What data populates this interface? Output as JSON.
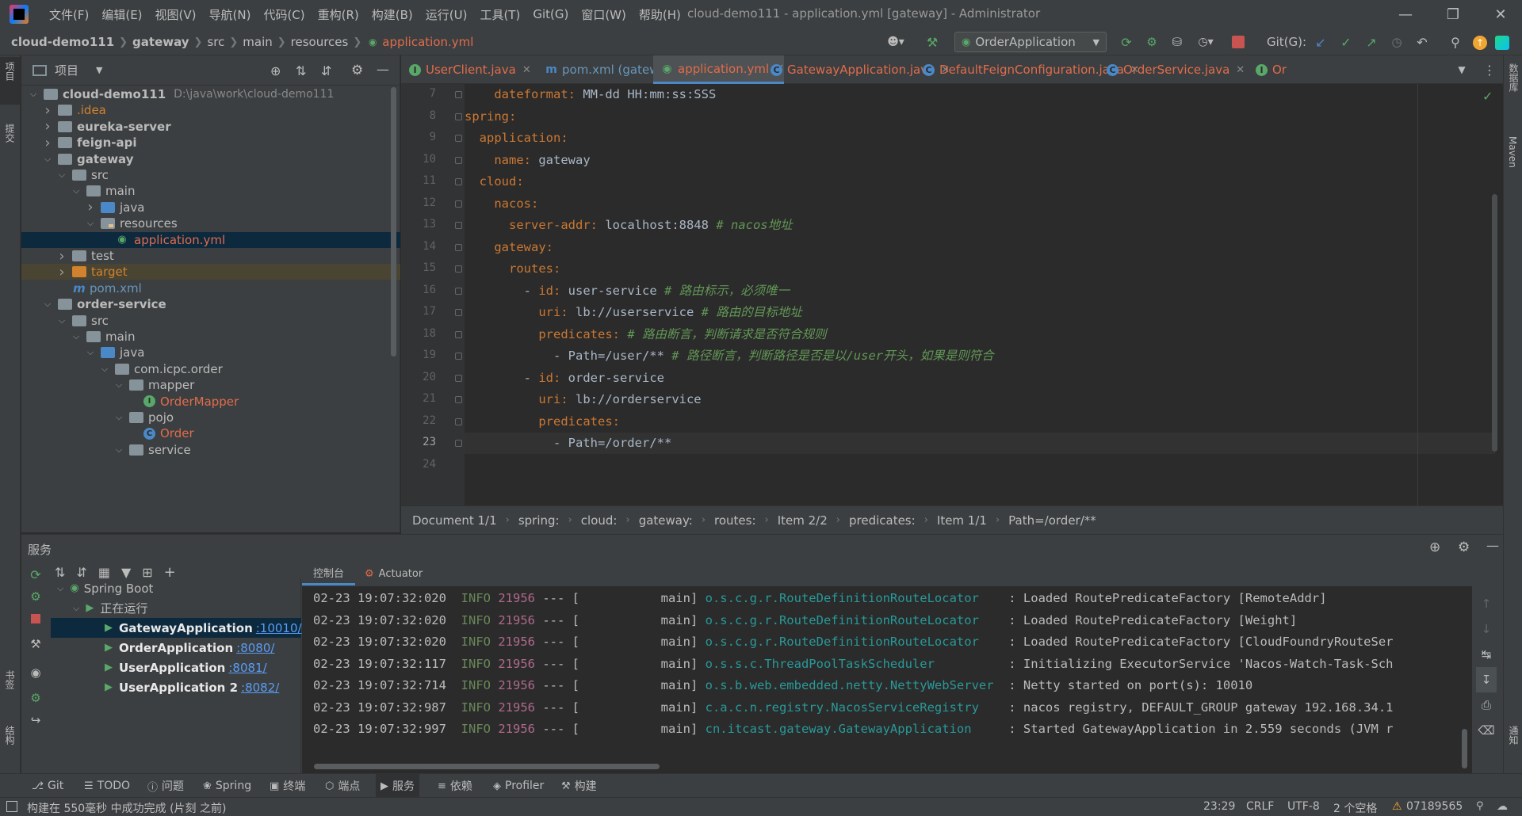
{
  "window": {
    "title": "cloud-demo111 - application.yml [gateway] - Administrator",
    "menu": [
      "文件(F)",
      "编辑(E)",
      "视图(V)",
      "导航(N)",
      "代码(C)",
      "重构(R)",
      "构建(B)",
      "运行(U)",
      "工具(T)",
      "Git(G)",
      "窗口(W)",
      "帮助(H)"
    ]
  },
  "breadcrumbs": [
    "cloud-demo111",
    "gateway",
    "src",
    "main",
    "resources",
    "application.yml"
  ],
  "run_config": "OrderApplication",
  "git_label": "Git(G):",
  "project_panel": {
    "title": "项目",
    "tree": [
      {
        "label": "cloud-demo111",
        "path": "D:\\java\\work\\cloud-demo111",
        "type": "module",
        "arrow": "v"
      },
      {
        "label": ".idea",
        "type": "folder",
        "arrow": ">"
      },
      {
        "label": "eureka-server",
        "type": "module",
        "arrow": ">"
      },
      {
        "label": "feign-api",
        "type": "module",
        "arrow": ">"
      },
      {
        "label": "gateway",
        "type": "module",
        "arrow": "v"
      },
      {
        "label": "src",
        "type": "folder",
        "arrow": "v"
      },
      {
        "label": "main",
        "type": "folder",
        "arrow": "v"
      },
      {
        "label": "java",
        "type": "source",
        "arrow": ">"
      },
      {
        "label": "resources",
        "type": "resources",
        "arrow": "v"
      },
      {
        "label": "application.yml",
        "type": "yml",
        "arrow": ""
      },
      {
        "label": "test",
        "type": "folder",
        "arrow": ">"
      },
      {
        "label": "target",
        "type": "excluded",
        "arrow": ">"
      },
      {
        "label": "pom.xml",
        "type": "maven",
        "arrow": ""
      },
      {
        "label": "order-service",
        "type": "module",
        "arrow": "v"
      },
      {
        "label": "src",
        "type": "folder",
        "arrow": "v"
      },
      {
        "label": "main",
        "type": "folder",
        "arrow": "v"
      },
      {
        "label": "java",
        "type": "source",
        "arrow": "v"
      },
      {
        "label": "com.icpc.order",
        "type": "package",
        "arrow": "v"
      },
      {
        "label": "mapper",
        "type": "package",
        "arrow": "v"
      },
      {
        "label": "OrderMapper",
        "type": "interface",
        "arrow": ""
      },
      {
        "label": "pojo",
        "type": "package",
        "arrow": "v"
      },
      {
        "label": "Order",
        "type": "class",
        "arrow": ""
      },
      {
        "label": "service",
        "type": "package",
        "arrow": "v"
      }
    ]
  },
  "editor_tabs": [
    {
      "label": "UserClient.java",
      "icon": "interface-icon"
    },
    {
      "label": "pom.xml (gateway)",
      "icon": "maven-icon"
    },
    {
      "label": "application.yml",
      "icon": "yml-icon",
      "active": true
    },
    {
      "label": "GatewayApplication.java",
      "icon": "class-icon"
    },
    {
      "label": "DefaultFeignConfiguration.java",
      "icon": "class-icon"
    },
    {
      "label": "OrderService.java",
      "icon": "class-icon"
    },
    {
      "label": "Or",
      "icon": "interface-icon"
    }
  ],
  "code_lines": [
    {
      "n": "7",
      "key": "dateformat",
      "val": " MM-dd HH:mm:ss:SSS",
      "comment": "",
      "indent": "    "
    },
    {
      "n": "8",
      "key": "spring",
      "val": "",
      "comment": "",
      "indent": ""
    },
    {
      "n": "9",
      "key": "application",
      "val": "",
      "comment": "",
      "indent": "  "
    },
    {
      "n": "10",
      "key": "name",
      "val": " gateway",
      "comment": "",
      "indent": "    "
    },
    {
      "n": "11",
      "key": "cloud",
      "val": "",
      "comment": "",
      "indent": "  "
    },
    {
      "n": "12",
      "key": "nacos",
      "val": "",
      "comment": "",
      "indent": "    "
    },
    {
      "n": "13",
      "key": "server-addr",
      "val": " localhost:8848",
      "comment": " # nacos地址",
      "indent": "      "
    },
    {
      "n": "14",
      "key": "gateway",
      "val": "",
      "comment": "",
      "indent": "    "
    },
    {
      "n": "15",
      "key": "routes",
      "val": "",
      "comment": "",
      "indent": "      "
    },
    {
      "n": "16",
      "key": "id",
      "val": " user-service",
      "comment": " # 路由标示，必须唯一",
      "indent": "        - "
    },
    {
      "n": "17",
      "key": "uri",
      "val": " lb://userservice",
      "comment": " # 路由的目标地址",
      "indent": "          "
    },
    {
      "n": "18",
      "key": "predicates",
      "val": "",
      "comment": " # 路由断言，判断请求是否符合规则",
      "indent": "          "
    },
    {
      "n": "19",
      "key": "",
      "val": "            - Path=/user/**",
      "comment": " # 路径断言，判断路径是否是以/user开头，如果是则符合",
      "indent": ""
    },
    {
      "n": "20",
      "key": "id",
      "val": " order-service",
      "comment": "",
      "indent": "        - "
    },
    {
      "n": "21",
      "key": "uri",
      "val": " lb://orderservice",
      "comment": "",
      "indent": "          "
    },
    {
      "n": "22",
      "key": "predicates",
      "val": "",
      "comment": "",
      "indent": "          "
    },
    {
      "n": "23",
      "key": "",
      "val": "            - Path=/order/**",
      "comment": "",
      "indent": ""
    },
    {
      "n": "24",
      "key": "",
      "val": "",
      "comment": "",
      "indent": ""
    }
  ],
  "editor_breadcrumb": [
    "Document 1/1",
    "spring:",
    "cloud:",
    "gateway:",
    "routes:",
    "Item 2/2",
    "predicates:",
    "Item 1/1",
    "Path=/order/**"
  ],
  "services": {
    "title": "服务",
    "console_tabs": [
      "控制台",
      "Actuator"
    ],
    "tree": [
      {
        "label": "Spring Boot",
        "port": "",
        "level": 0
      },
      {
        "label": "正在运行",
        "port": "",
        "level": 1
      },
      {
        "label": "GatewayApplication",
        "port": ":10010/",
        "level": 2,
        "selected": true
      },
      {
        "label": "OrderApplication",
        "port": ":8080/",
        "level": 2
      },
      {
        "label": "UserApplication",
        "port": ":8081/",
        "level": 2
      },
      {
        "label": "UserApplication 2",
        "port": ":8082/",
        "level": 2
      }
    ],
    "logs": [
      {
        "ts": "02-23 19:07:32:020",
        "lvl": "INFO",
        "pid": "21956",
        "thread": " --- [           main] ",
        "cls": "o.s.c.g.r.RouteDefinitionRouteLocator   ",
        "msg": " : Loaded RoutePredicateFactory [RemoteAddr]"
      },
      {
        "ts": "02-23 19:07:32:020",
        "lvl": "INFO",
        "pid": "21956",
        "thread": " --- [           main] ",
        "cls": "o.s.c.g.r.RouteDefinitionRouteLocator   ",
        "msg": " : Loaded RoutePredicateFactory [Weight]"
      },
      {
        "ts": "02-23 19:07:32:020",
        "lvl": "INFO",
        "pid": "21956",
        "thread": " --- [           main] ",
        "cls": "o.s.c.g.r.RouteDefinitionRouteLocator   ",
        "msg": " : Loaded RoutePredicateFactory [CloudFoundryRouteSer"
      },
      {
        "ts": "02-23 19:07:32:117",
        "lvl": "INFO",
        "pid": "21956",
        "thread": " --- [           main] ",
        "cls": "o.s.s.c.ThreadPoolTaskScheduler         ",
        "msg": " : Initializing ExecutorService 'Nacos-Watch-Task-Sch"
      },
      {
        "ts": "02-23 19:07:32:714",
        "lvl": "INFO",
        "pid": "21956",
        "thread": " --- [           main] ",
        "cls": "o.s.b.web.embedded.netty.NettyWebServer ",
        "msg": " : Netty started on port(s): 10010"
      },
      {
        "ts": "02-23 19:07:32:987",
        "lvl": "INFO",
        "pid": "21956",
        "thread": " --- [           main] ",
        "cls": "c.a.c.n.registry.NacosServiceRegistry   ",
        "msg": " : nacos registry, DEFAULT_GROUP gateway 192.168.34.1"
      },
      {
        "ts": "02-23 19:07:32:997",
        "lvl": "INFO",
        "pid": "21956",
        "thread": " --- [           main] ",
        "cls": "cn.itcast.gateway.GatewayApplication    ",
        "msg": " : Started GatewayApplication in 2.559 seconds (JVM r"
      }
    ]
  },
  "bottom_tools": [
    {
      "label": "Git",
      "icon": "git-icon"
    },
    {
      "label": "TODO",
      "icon": "list-icon"
    },
    {
      "label": "问题",
      "icon": "problems-icon"
    },
    {
      "label": "Spring",
      "icon": "spring-icon"
    },
    {
      "label": "终端",
      "icon": "terminal-icon"
    },
    {
      "label": "端点",
      "icon": "endpoints-icon"
    },
    {
      "label": "服务",
      "icon": "services-icon",
      "active": true
    },
    {
      "label": "依赖",
      "icon": "dependencies-icon"
    },
    {
      "label": "Profiler",
      "icon": "profiler-icon"
    },
    {
      "label": "构建",
      "icon": "build-icon"
    }
  ],
  "status": {
    "message": "构建在 550毫秒 中成功完成 (片刻 之前)",
    "position": "23:29",
    "line_sep": "CRLF",
    "encoding": "UTF-8",
    "indent": "2 个空格",
    "warnings": "07189565"
  },
  "side_labels": {
    "left_top": "项目",
    "left_commit": "提交",
    "left_bookmarks": "书签",
    "left_structure": "结构",
    "right_db": "数据库",
    "right_maven": "Maven",
    "right_notify": "通知"
  },
  "colors": {
    "accent": "#4a88c7",
    "yaml_key": "#cc7832",
    "comment": "#629755",
    "run_green": "#59a869",
    "log_class": "#299999",
    "selection": "#0d293e"
  }
}
